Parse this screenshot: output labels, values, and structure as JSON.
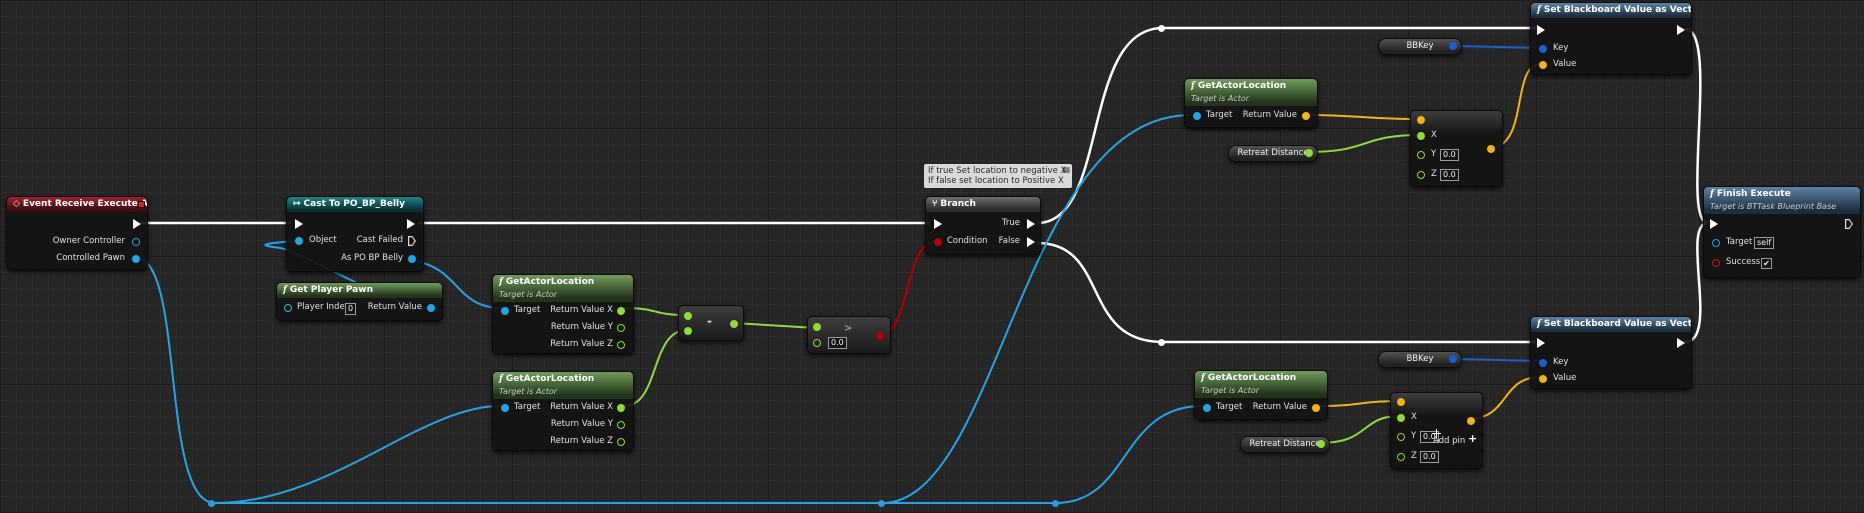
{
  "graph": {
    "colors": {
      "background": "#262626",
      "exec_wire": "#ffffff",
      "object_wire": "#24a4e6",
      "vector_wire": "#f1b21d",
      "float_wire": "#8edc3c",
      "bool_wire": "#b30000",
      "event_header": "#a2202b",
      "cast_header": "#1f8486",
      "pure_function_header": "#6f9d5a",
      "function_header": "#5c84a5"
    }
  },
  "nodes": {
    "event": {
      "title": "Event Receive Execute AI",
      "pins": [
        "Owner Controller",
        "Controlled Pawn"
      ]
    },
    "cast": {
      "title": "Cast To PO_BP_Belly",
      "in_object": "Object",
      "cast_failed": "Cast Failed",
      "as_label": "As PO BP Belly"
    },
    "get_player_pawn": {
      "title": "Get Player Pawn",
      "player_index_label": "Player Index",
      "player_index_value": "0",
      "return_label": "Return Value"
    },
    "gal1": {
      "title": "GetActorLocation",
      "subtitle": "Target is Actor",
      "target": "Target",
      "rx": "Return Value X",
      "ry": "Return Value Y",
      "rz": "Return Value Z"
    },
    "gal2": {
      "title": "GetActorLocation",
      "subtitle": "Target is Actor",
      "target": "Target",
      "rx": "Return Value X",
      "ry": "Return Value Y",
      "rz": "Return Value Z"
    },
    "subtract": {
      "op": "-"
    },
    "compare": {
      "value": "0.0"
    },
    "comment": {
      "line1": "If true Set location to negative X",
      "line2": "If false set location to Positive X"
    },
    "branch": {
      "title": "Branch",
      "condition": "Condition",
      "true_label": "True",
      "false_label": "False"
    },
    "gal3": {
      "title": "GetActorLocation",
      "subtitle": "Target is Actor",
      "target": "Target",
      "return": "Return Value"
    },
    "gal4": {
      "title": "GetActorLocation",
      "subtitle": "Target is Actor",
      "target": "Target",
      "return": "Return Value"
    },
    "retreat1": {
      "label": "Retreat Distance"
    },
    "retreat2": {
      "label": "Retreat Distance"
    },
    "make1": {
      "x": "X",
      "y": "Y",
      "z": "Z",
      "y_value": "0.0",
      "z_value": "0.0"
    },
    "make2": {
      "x": "X",
      "y": "Y",
      "z": "Z",
      "y_value": "0.0",
      "z_value": "0.0",
      "add_pin": "Add pin"
    },
    "bbkey1": {
      "label": "BBKey"
    },
    "bbkey2": {
      "label": "BBKey"
    },
    "setbb1": {
      "title": "Set Blackboard Value as Vector",
      "key": "Key",
      "value": "Value"
    },
    "setbb2": {
      "title": "Set Blackboard Value as Vector",
      "key": "Key",
      "value": "Value"
    },
    "finish": {
      "title": "Finish Execute",
      "subtitle": "Target is BTTask Blueprint Base",
      "target": "Target",
      "target_value": "self",
      "success": "Success",
      "success_checked": "✔"
    }
  }
}
